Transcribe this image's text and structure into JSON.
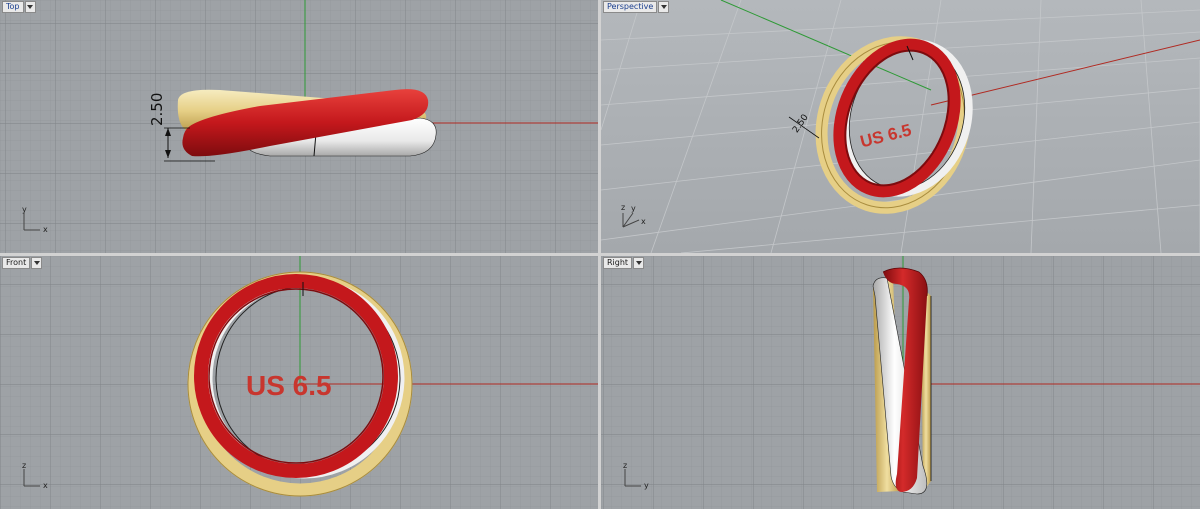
{
  "viewports": {
    "top": {
      "label": "Top",
      "dimension_text": "2.50"
    },
    "perspective": {
      "label": "Perspective",
      "size_label": "US 6.5",
      "dimension_text": "2.50"
    },
    "front": {
      "label": "Front",
      "size_label": "US 6.5"
    },
    "right": {
      "label": "Right"
    }
  },
  "axes": {
    "x": "x",
    "y": "y",
    "z": "z"
  },
  "colors": {
    "grid_bg": "#9ea2a6",
    "grid_line": "#8f9397",
    "x_axis": "#b02a22",
    "y_axis": "#2e9a36",
    "ring_red": "#c4181c",
    "ring_gold": "#e9d592",
    "ring_white": "#f0f0f0",
    "size_text": "#c8362e"
  },
  "icons": [
    "chevron-down-icon",
    "axis-widget-icon"
  ]
}
